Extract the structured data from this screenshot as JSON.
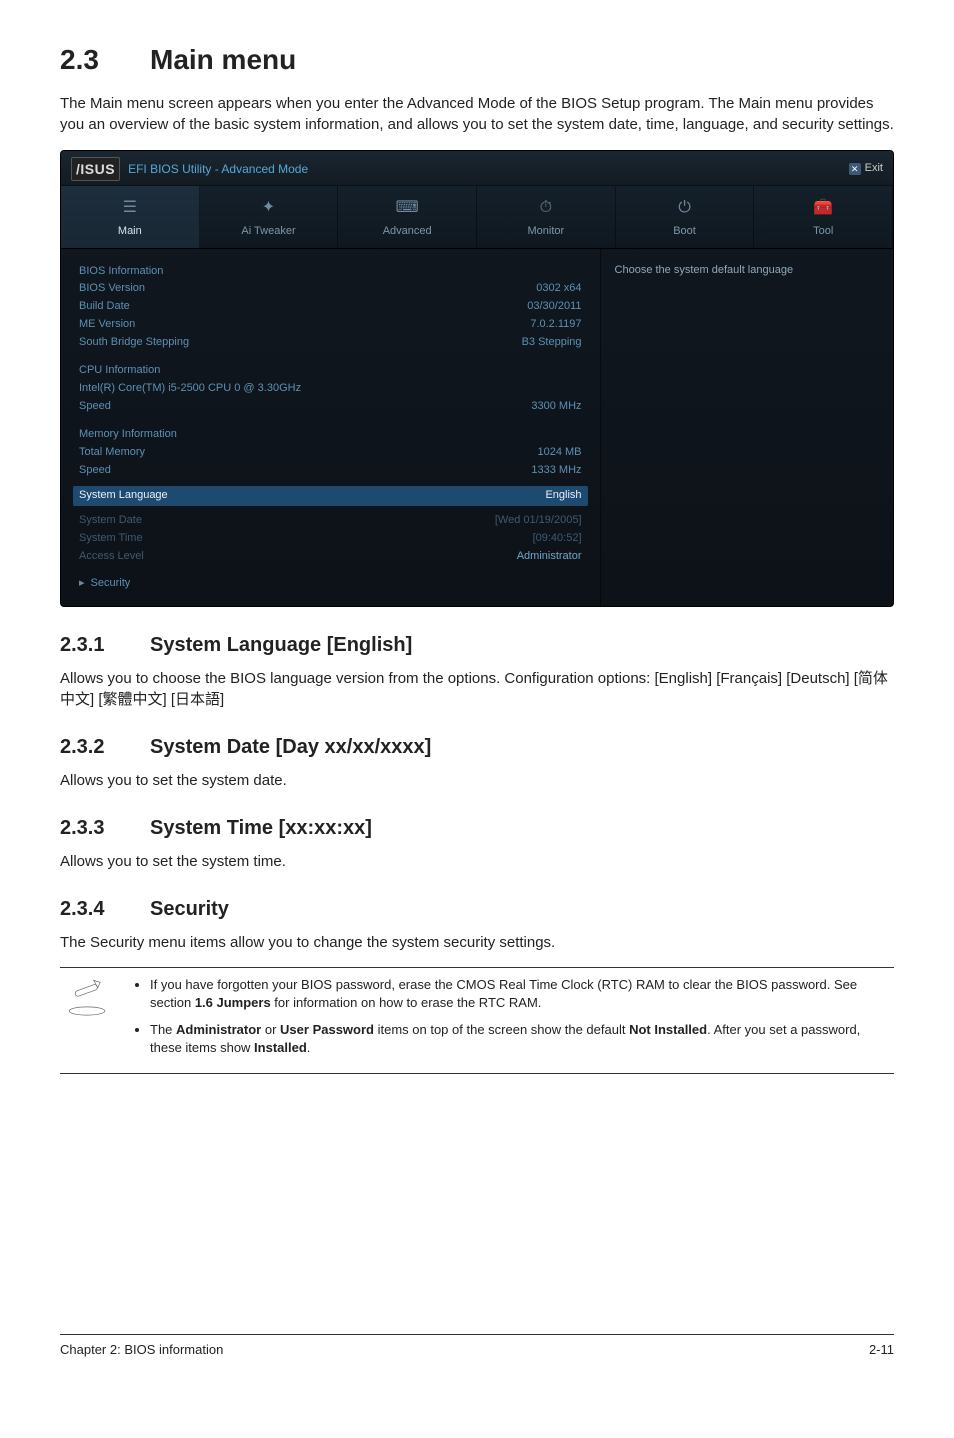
{
  "section": {
    "number": "2.3",
    "title": "Main menu",
    "intro": "The Main menu screen appears when you enter the Advanced Mode of the BIOS Setup program. The Main menu provides you an overview of the basic system information, and allows you to set the system date, time, language, and security settings."
  },
  "bios": {
    "brand": "/ISUS",
    "title": "EFI BIOS Utility - Advanced Mode",
    "exit": "Exit",
    "tabs": {
      "main": "Main",
      "ai_tweaker": "Ai Tweaker",
      "advanced": "Advanced",
      "monitor": "Monitor",
      "boot": "Boot",
      "tool": "Tool"
    },
    "right_help": "Choose the system default language",
    "info": {
      "bios_information": "BIOS Information",
      "bios_version_label": "BIOS Version",
      "bios_version_value": "0302 x64",
      "build_date_label": "Build Date",
      "build_date_value": "03/30/2011",
      "me_version_label": "ME Version",
      "me_version_value": "7.0.2.1197",
      "south_bridge_label": "South Bridge Stepping",
      "south_bridge_value": "B3 Stepping",
      "cpu_information": "CPU Information",
      "cpu_model": "Intel(R) Core(TM) i5-2500 CPU 0 @ 3.30GHz",
      "cpu_speed_label": "Speed",
      "cpu_speed_value": "3300 MHz",
      "memory_information": "Memory Information",
      "total_memory_label": "Total Memory",
      "total_memory_value": "1024 MB",
      "mem_speed_label": "Speed",
      "mem_speed_value": "1333 MHz",
      "system_language_label": "System Language",
      "system_language_value": "English",
      "system_date_label": "System Date",
      "system_date_value": "[Wed 01/19/2005]",
      "system_time_label": "System Time",
      "system_time_value": "[09:40:52]",
      "access_level_label": "Access Level",
      "access_level_value": "Administrator",
      "security": "Security"
    }
  },
  "subs": {
    "s231": {
      "num": "2.3.1",
      "title": "System Language [English]",
      "body": "Allows you to choose the BIOS language version from the options. Configuration options: [English] [Français] [Deutsch] [简体中文] [繁體中文] [日本語]"
    },
    "s232": {
      "num": "2.3.2",
      "title": "System Date [Day xx/xx/xxxx]",
      "body": "Allows you to set the system date."
    },
    "s233": {
      "num": "2.3.3",
      "title": "System Time [xx:xx:xx]",
      "body": "Allows you to set the system time."
    },
    "s234": {
      "num": "2.3.4",
      "title": "Security",
      "body": "The Security menu items allow you to change the system security settings."
    }
  },
  "notes": {
    "n1_a": "If you have forgotten your BIOS password, erase the CMOS Real Time Clock (RTC) RAM to clear the BIOS password. See section ",
    "n1_b": "1.6 Jumpers",
    "n1_c": " for information on how to erase the RTC RAM.",
    "n2_a": "The ",
    "n2_b": "Administrator",
    "n2_c": " or ",
    "n2_d": "User Password",
    "n2_e": " items on top of the screen show the default ",
    "n2_f": "Not Installed",
    "n2_g": ". After you set a password, these items show ",
    "n2_h": "Installed",
    "n2_i": "."
  },
  "footer": {
    "left": "Chapter 2: BIOS information",
    "right": "2-11"
  }
}
